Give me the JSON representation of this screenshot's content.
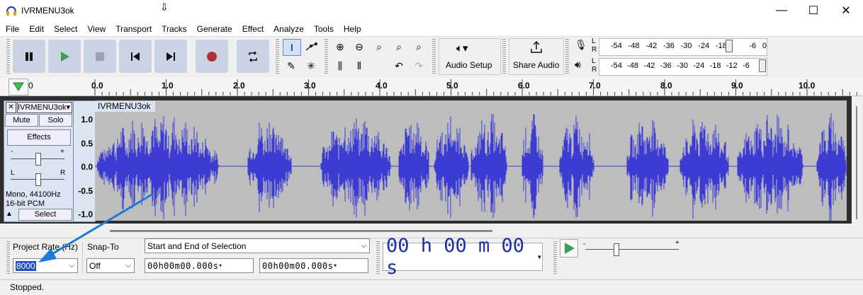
{
  "window": {
    "title": "IVRMENU3ok",
    "minimize": "—",
    "maximize": "☐",
    "close": "✕"
  },
  "menu": [
    "File",
    "Edit",
    "Select",
    "View",
    "Transport",
    "Tracks",
    "Generate",
    "Effect",
    "Analyze",
    "Tools",
    "Help"
  ],
  "toolbar": {
    "audio_setup": "Audio Setup",
    "share_audio": "Share Audio",
    "rec_meter_labels": [
      "-54",
      "-48",
      "-42",
      "-36",
      "-30",
      "-24",
      "-18",
      "",
      "-6",
      "0"
    ],
    "play_meter_labels": [
      "-54",
      "-48",
      "-42",
      "-36",
      "-30",
      "-24",
      "-18",
      "-12",
      "-6",
      ""
    ],
    "meter_lr": [
      "L",
      "R"
    ]
  },
  "ruler": {
    "labels": [
      "0",
      "0.0",
      "1.0",
      "2.0",
      "3.0",
      "4.0",
      "5.0",
      "6.0",
      "7.0",
      "8.0",
      "9.0",
      "10.0"
    ]
  },
  "track": {
    "name": "IVRMENU3ok",
    "mute": "Mute",
    "solo": "Solo",
    "effects": "Effects",
    "gain_minus": "-",
    "gain_plus": "+",
    "pan_l": "L",
    "pan_r": "R",
    "info_line1": "Mono, 44100Hz",
    "info_line2": "16-bit PCM",
    "select": "Select",
    "scale": [
      "1.0",
      "0.5",
      "0.0",
      "-0.5",
      "-1.0"
    ],
    "clip_name": "IVRMENU3ok"
  },
  "selection": {
    "project_rate_label": "Project Rate (Hz)",
    "project_rate_value": "8000",
    "snap_to_label": "Snap-To",
    "snap_to_value": "Off",
    "selection_mode": "Start and End of Selection",
    "start_time": "00h00m00.000s",
    "end_time": "00h00m00.000s",
    "audio_position": "00 h 00 m 00 s"
  },
  "status": {
    "text": "Stopped."
  },
  "colors": {
    "waveform": "#3c3cd2",
    "track_bg": "#bdbdbd",
    "accent_arrow": "#1e7ad8",
    "record": "#b3303b"
  }
}
